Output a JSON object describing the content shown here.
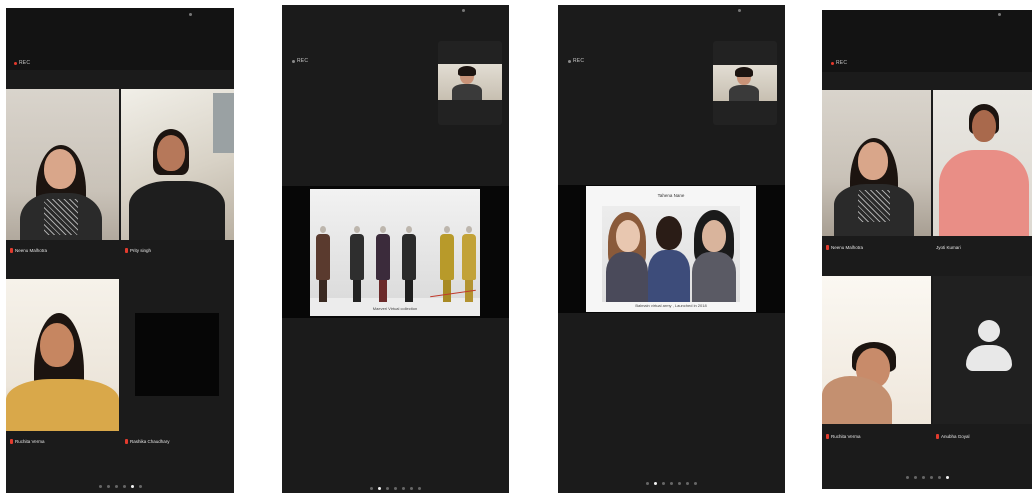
{
  "screens": [
    {
      "rec_label": "REC",
      "participants": [
        {
          "name": "Neenu Malhotra"
        },
        {
          "name": "Prity singh"
        },
        {
          "name": "Ruchita Verma"
        },
        {
          "name": "Rashika Chaudhary"
        }
      ],
      "page_dots": {
        "count": 6,
        "active": 4
      }
    },
    {
      "rec_label": "REC",
      "slide_caption": "Maeveri Virtual collection",
      "page_dots": {
        "count": 7,
        "active": 1
      }
    },
    {
      "rec_label": "REC",
      "slide_title": "Tahena Nane",
      "slide_caption": "Balmain virtual army , Launched in 2018",
      "page_dots": {
        "count": 7,
        "active": 1
      }
    },
    {
      "rec_label": "REC",
      "participants": [
        {
          "name": "Neenu Malhotra"
        },
        {
          "name": "Jyoti Kumari"
        },
        {
          "name": "Ruchita Verma"
        },
        {
          "name": "Anubha Goyal"
        }
      ],
      "page_dots": {
        "count": 6,
        "active": 5
      }
    }
  ],
  "colors": {
    "rec": "#e5392c",
    "mic_muted": "#e23b2e",
    "background": "#1b1b1b"
  }
}
